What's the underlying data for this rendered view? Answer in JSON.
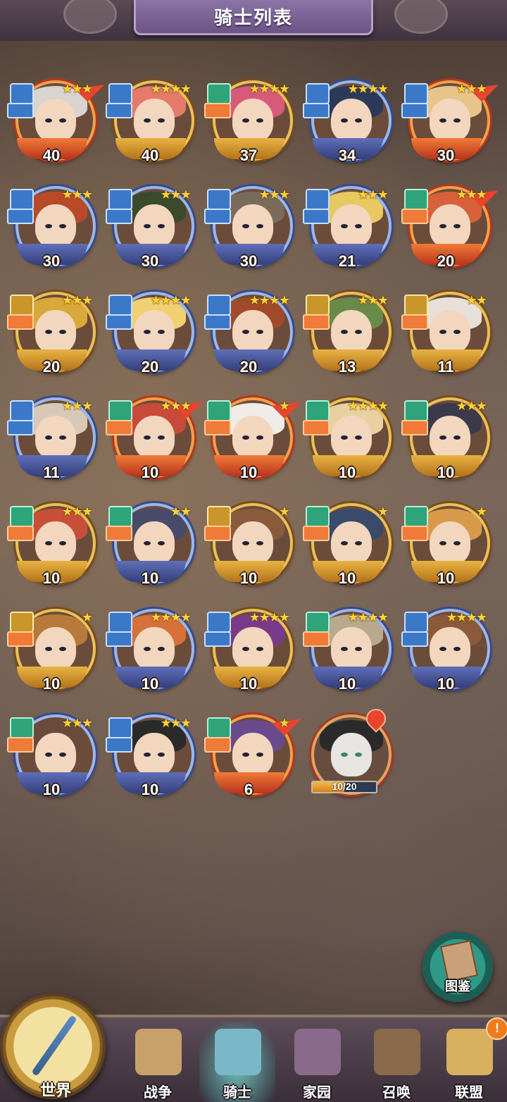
{
  "header": {
    "title": "骑士列表"
  },
  "heroes": [
    {
      "level": "40",
      "stars": "★★★",
      "frame": "red",
      "upgrade": true,
      "badge": "blue",
      "color": "#d8d4d0"
    },
    {
      "level": "40",
      "stars": "★★★★",
      "frame": "gold",
      "upgrade": false,
      "badge": "blue",
      "color": "#e57a6a"
    },
    {
      "level": "37",
      "stars": "★★★★",
      "frame": "gold",
      "upgrade": false,
      "badge": "green",
      "color": "#d85a7a"
    },
    {
      "level": "34",
      "stars": "★★★★",
      "frame": "blue",
      "upgrade": false,
      "badge": "blue",
      "color": "#2b3a5a"
    },
    {
      "level": "30",
      "stars": "★★★",
      "frame": "red",
      "upgrade": true,
      "badge": "blue",
      "color": "#e8c48a"
    },
    {
      "level": "30",
      "stars": "★★★",
      "frame": "blue",
      "upgrade": false,
      "badge": "blue",
      "color": "#b84a2a"
    },
    {
      "level": "30",
      "stars": "★★★",
      "frame": "blue",
      "upgrade": false,
      "badge": "blue",
      "color": "#3a4a2a"
    },
    {
      "level": "30",
      "stars": "★★★",
      "frame": "blue",
      "upgrade": false,
      "badge": "blue",
      "color": "#7a6a5a"
    },
    {
      "level": "21",
      "stars": "★★★",
      "frame": "blue",
      "upgrade": false,
      "badge": "blue",
      "color": "#e8c860"
    },
    {
      "level": "20",
      "stars": "★★★",
      "frame": "red",
      "upgrade": true,
      "badge": "green",
      "color": "#d8603a"
    },
    {
      "level": "20",
      "stars": "★★★",
      "frame": "gold",
      "upgrade": false,
      "badge": "gold",
      "color": "#d8a83a"
    },
    {
      "level": "20",
      "stars": "★★★★",
      "frame": "blue",
      "upgrade": false,
      "badge": "blue",
      "color": "#f0d070"
    },
    {
      "level": "20",
      "stars": "★★★★",
      "frame": "blue",
      "upgrade": false,
      "badge": "blue",
      "color": "#a04a2a"
    },
    {
      "level": "13",
      "stars": "★★★",
      "frame": "gold",
      "upgrade": false,
      "badge": "gold",
      "color": "#6a8a4a"
    },
    {
      "level": "11",
      "stars": "★★",
      "frame": "gold",
      "upgrade": false,
      "badge": "gold",
      "color": "#e8e0d8"
    },
    {
      "level": "11",
      "stars": "★★★",
      "frame": "blue",
      "upgrade": false,
      "badge": "blue",
      "color": "#d8c8b8"
    },
    {
      "level": "10",
      "stars": "★★★",
      "frame": "red",
      "upgrade": true,
      "badge": "green",
      "color": "#c84a3a"
    },
    {
      "level": "10",
      "stars": "★",
      "frame": "red",
      "upgrade": true,
      "badge": "green",
      "color": "#f0ece8"
    },
    {
      "level": "10",
      "stars": "★★★★",
      "frame": "gold",
      "upgrade": false,
      "badge": "green",
      "color": "#e8d0a0"
    },
    {
      "level": "10",
      "stars": "★★★",
      "frame": "gold",
      "upgrade": false,
      "badge": "green",
      "color": "#3a3a4a"
    },
    {
      "level": "10",
      "stars": "★★★",
      "frame": "gold",
      "upgrade": false,
      "badge": "green",
      "color": "#c8503a"
    },
    {
      "level": "10",
      "stars": "★★",
      "frame": "blue",
      "upgrade": false,
      "badge": "green",
      "color": "#4a4a6a"
    },
    {
      "level": "10",
      "stars": "★",
      "frame": "gold",
      "upgrade": false,
      "badge": "gold",
      "color": "#8a5a3a"
    },
    {
      "level": "10",
      "stars": "★",
      "frame": "gold",
      "upgrade": false,
      "badge": "green",
      "color": "#3a4a6a"
    },
    {
      "level": "10",
      "stars": "★",
      "frame": "gold",
      "upgrade": false,
      "badge": "green",
      "color": "#d89a4a"
    },
    {
      "level": "10",
      "stars": "★",
      "frame": "gold",
      "upgrade": false,
      "badge": "gold",
      "color": "#b87a3a"
    },
    {
      "level": "10",
      "stars": "★★★★",
      "frame": "blue",
      "upgrade": false,
      "badge": "blue",
      "color": "#d8703a"
    },
    {
      "level": "10",
      "stars": "★★★★",
      "frame": "gold",
      "upgrade": false,
      "badge": "blue",
      "color": "#7a3a8a"
    },
    {
      "level": "10",
      "stars": "★★★★",
      "frame": "blue",
      "upgrade": false,
      "badge": "green",
      "color": "#b8a890"
    },
    {
      "level": "10",
      "stars": "★★★★",
      "frame": "blue",
      "upgrade": false,
      "badge": "blue",
      "color": "#8a5a3a"
    },
    {
      "level": "10",
      "stars": "★★★",
      "frame": "blue",
      "upgrade": false,
      "badge": "green",
      "color": "#6a4a3a"
    },
    {
      "level": "10",
      "stars": "★★★",
      "frame": "blue",
      "upgrade": false,
      "badge": "blue",
      "color": "#2a2a2a"
    },
    {
      "level": "6",
      "stars": "★",
      "frame": "red",
      "upgrade": true,
      "badge": "green",
      "color": "#6a4a8a"
    }
  ],
  "locked_hero": {
    "progress_text": "10/20",
    "progress": 0.5
  },
  "codex": {
    "label": "图鉴"
  },
  "nav": {
    "world": "世界",
    "items": [
      {
        "label": "战争",
        "color": "#c8a06a"
      },
      {
        "label": "骑士",
        "color": "#7ab8c8"
      },
      {
        "label": "家园",
        "color": "#8a6a8a"
      },
      {
        "label": "召唤",
        "color": "#8a6a4a"
      },
      {
        "label": "联盟",
        "color": "#d8b060"
      }
    ],
    "active_index": 1,
    "alert": "!"
  }
}
